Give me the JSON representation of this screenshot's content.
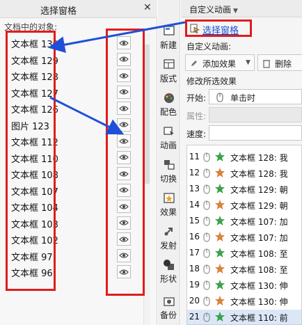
{
  "selection_pane": {
    "title": "选择窗格",
    "close_label": "✕",
    "objects_label": "文档中的对象:",
    "objects": [
      {
        "name": "文本框 130"
      },
      {
        "name": "文本框 129"
      },
      {
        "name": "文本框 128"
      },
      {
        "name": "文本框 127"
      },
      {
        "name": "文本框 126"
      },
      {
        "name": "图片 123"
      },
      {
        "name": "文本框 112"
      },
      {
        "name": "文本框 110"
      },
      {
        "name": "文本框 108"
      },
      {
        "name": "文本框 107"
      },
      {
        "name": "文本框 104"
      },
      {
        "name": "文本框 103"
      },
      {
        "name": "文本框 102"
      },
      {
        "name": "文本框 97"
      },
      {
        "name": "文本框 96"
      }
    ]
  },
  "tool_bar": {
    "items": [
      {
        "label": "新建",
        "icon": "new-slide-icon"
      },
      {
        "label": "版式",
        "icon": "layout-icon"
      },
      {
        "label": "配色",
        "icon": "palette-icon"
      },
      {
        "label": "动画",
        "icon": "animation-icon"
      },
      {
        "label": "切换",
        "icon": "transition-icon"
      },
      {
        "label": "效果",
        "icon": "effect-icon"
      },
      {
        "label": "发射",
        "icon": "launch-icon"
      },
      {
        "label": "形状",
        "icon": "shape-icon"
      },
      {
        "label": "备份",
        "icon": "backup-icon"
      }
    ]
  },
  "animation_pane": {
    "title": "自定义动画",
    "selection_pane_link": "选择窗格",
    "custom_animation_label": "自定义动画:",
    "add_effect_label": "添加效果",
    "delete_label": "删除",
    "modify_label": "修改所选效果",
    "start_label": "开始:",
    "start_value": "单击时",
    "property_label": "属性:",
    "speed_label": "速度:",
    "items": [
      {
        "num": "11",
        "text": "文本框 128: 我"
      },
      {
        "num": "12",
        "text": "文本框 128: 我"
      },
      {
        "num": "13",
        "text": "文本框 129: 朝"
      },
      {
        "num": "14",
        "text": "文本框 129: 朝"
      },
      {
        "num": "15",
        "text": "文本框 107: 加"
      },
      {
        "num": "16",
        "text": "文本框 107: 加"
      },
      {
        "num": "17",
        "text": "文本框 108: 至"
      },
      {
        "num": "18",
        "text": "文本框 108: 至"
      },
      {
        "num": "19",
        "text": "文本框 130: 伸"
      },
      {
        "num": "20",
        "text": "文本框 130: 伸"
      },
      {
        "num": "21",
        "text": "文本框 110: 前"
      }
    ]
  },
  "colors": {
    "highlight_red": "#e31b1b",
    "annotation_blue": "#1f4fd8",
    "link_blue": "#1a4fd1"
  }
}
